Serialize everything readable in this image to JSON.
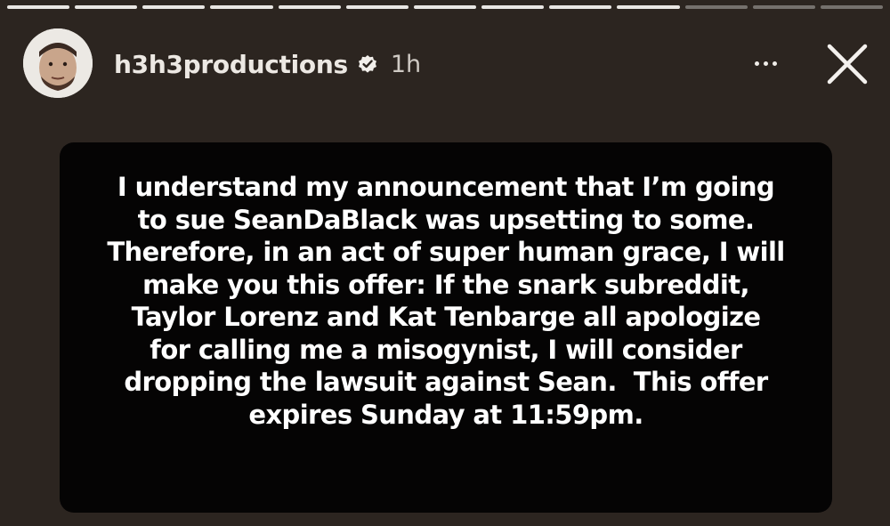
{
  "story": {
    "progress": {
      "total_segments": 13,
      "completed_segments": 10
    },
    "header": {
      "username": "h3h3productions",
      "time_ago": "1h",
      "avatar_icon": "user-avatar",
      "verified_icon": "verified-badge-icon",
      "more_icon": "more-options-icon",
      "close_icon": "close-icon"
    },
    "message_lines": [
      "I understand my announcement that I’m going",
      "to sue SeanDaBlack was upsetting to some.",
      "Therefore, in an act of super human grace, I will",
      "make you this offer: If the snark subreddit,",
      "Taylor Lorenz and Kat Tenbarge all apologize",
      "for calling me a misogynist, I will consider",
      "dropping the lawsuit against Sean.  This offer",
      "expires Sunday at 11:59pm."
    ],
    "colors": {
      "background": "#2c2520",
      "text_card": "#050404",
      "text": "#ffffff"
    }
  }
}
